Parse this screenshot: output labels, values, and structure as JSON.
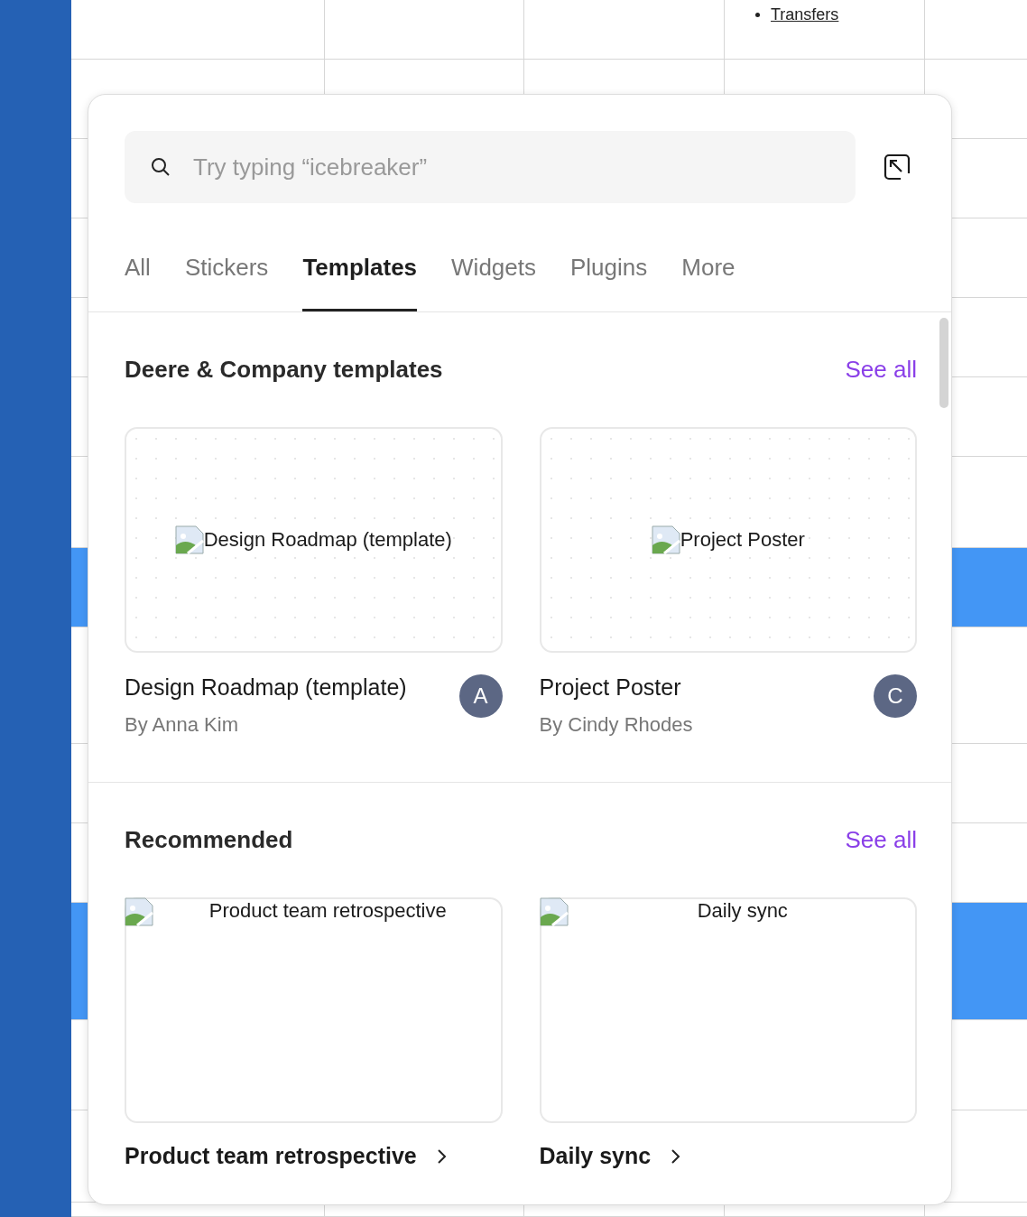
{
  "background": {
    "rows": [
      {
        "highlighted": false,
        "link": "Transfers"
      },
      {
        "highlighted": false
      },
      {
        "highlighted": false
      },
      {
        "highlighted": false
      },
      {
        "highlighted": false
      },
      {
        "highlighted": false
      },
      {
        "highlighted": false
      },
      {
        "highlighted": true
      },
      {
        "highlighted": false
      },
      {
        "highlighted": false
      },
      {
        "highlighted": false
      },
      {
        "highlighted": true
      },
      {
        "highlighted": false
      },
      {
        "highlighted": false
      },
      {
        "highlighted": false
      }
    ]
  },
  "panel": {
    "search": {
      "placeholder": "Try typing “icebreaker”"
    },
    "tabs": [
      {
        "label": "All",
        "selected": false
      },
      {
        "label": "Stickers",
        "selected": false
      },
      {
        "label": "Templates",
        "selected": true
      },
      {
        "label": "Widgets",
        "selected": false
      },
      {
        "label": "Plugins",
        "selected": false
      },
      {
        "label": "More",
        "selected": false
      }
    ],
    "sections": [
      {
        "kind": "authored",
        "title": "Deere & Company templates",
        "see_all": "See all",
        "items": [
          {
            "thumbnail_alt": "Design Roadmap (template)",
            "title": "Design Roadmap (template)",
            "author": "By Anna Kim",
            "avatar": "A"
          },
          {
            "thumbnail_alt": "Project Poster",
            "title": "Project Poster",
            "author": "By Cindy Rhodes",
            "avatar": "C"
          }
        ]
      },
      {
        "kind": "gallery",
        "title": "Recommended",
        "see_all": "See all",
        "items": [
          {
            "thumbnail_alt": "Product team retrospective",
            "title": "Product team retrospective"
          },
          {
            "thumbnail_alt": "Daily sync",
            "title": "Daily sync"
          }
        ]
      }
    ]
  }
}
